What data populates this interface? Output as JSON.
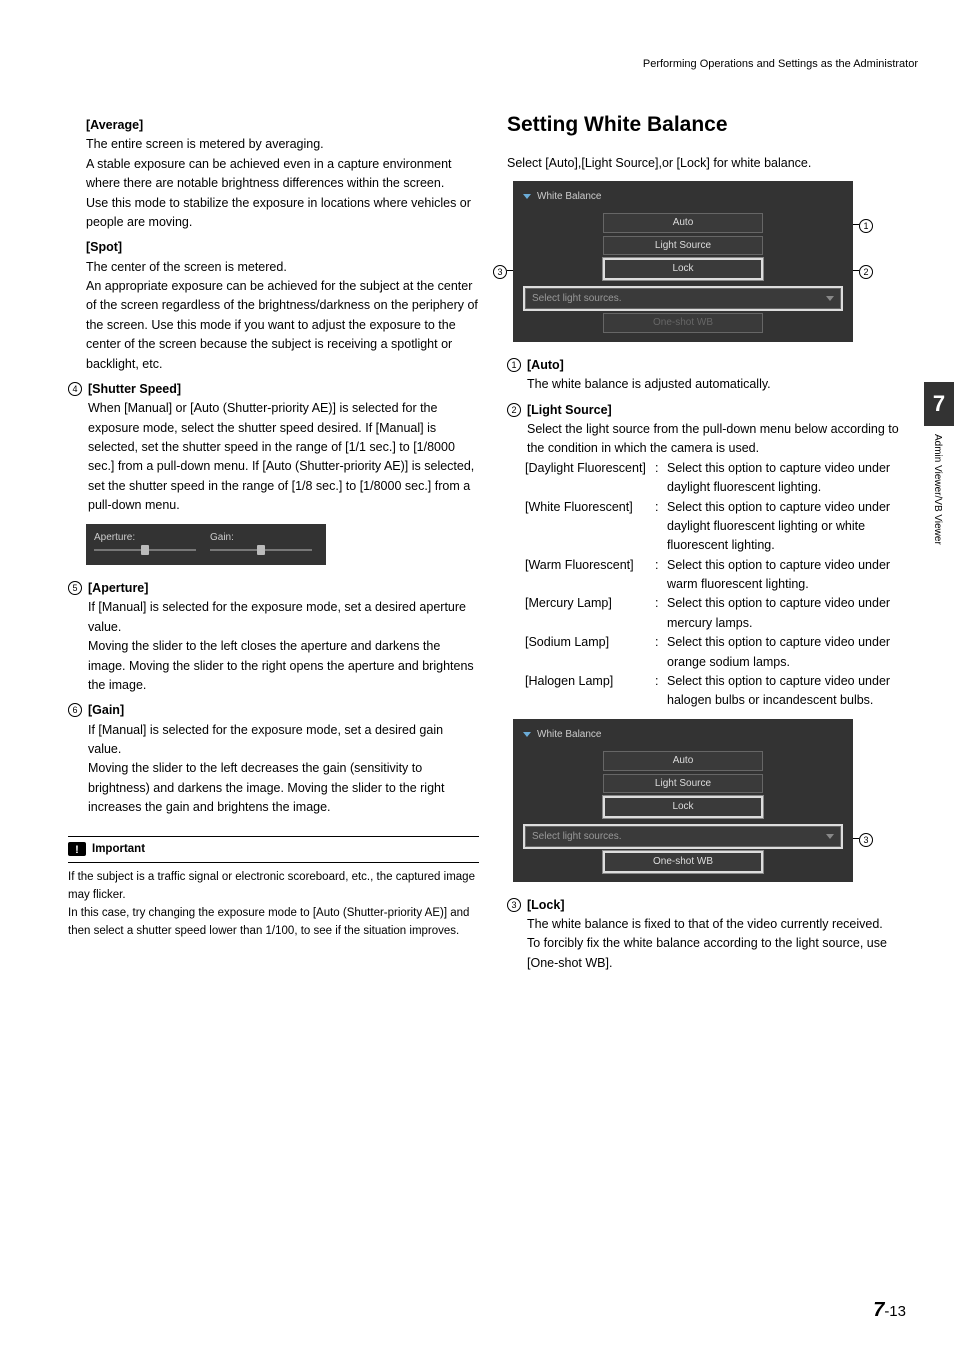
{
  "header": {
    "breadcrumb": "Performing Operations and Settings as the Administrator"
  },
  "sideTab": {
    "chapter": "7",
    "label": "Admin Viewer/VB Viewer"
  },
  "footer": {
    "chapter": "7",
    "page": "-13"
  },
  "left": {
    "avg": {
      "title": "[Average]",
      "body": "The entire screen is metered by averaging.\nA stable exposure can be achieved even in a capture environment where there are notable brightness differences within the screen.\nUse this mode to stabilize the exposure in locations where vehicles or people are moving."
    },
    "spot": {
      "title": "[Spot]",
      "body": "The center of the screen is metered.\nAn appropriate exposure can be achieved for the subject at the center of the screen regardless of the brightness/darkness on the periphery of the screen. Use this mode if you want to adjust the exposure to the center of the screen because the subject is receiving a spotlight or backlight, etc."
    },
    "shutter": {
      "num": "4",
      "title": "[Shutter Speed]",
      "body": "When [Manual] or [Auto (Shutter-priority AE)] is selected for the exposure mode, select the shutter speed desired.  If [Manual] is selected, set the shutter speed in the range of [1/1 sec.] to [1/8000 sec.] from a pull-down menu.  If [Auto (Shutter-priority AE)] is selected, set the shutter speed in the range of [1/8 sec.] to [1/8000 sec.] from a pull-down menu."
    },
    "sliders": {
      "aperture": "Aperture:",
      "gain": "Gain:"
    },
    "aperture": {
      "num": "5",
      "title": "[Aperture]",
      "body": "If [Manual] is selected for the exposure mode, set a desired aperture value.\nMoving the slider to the left closes the aperture and darkens the image. Moving the slider to the right opens the aperture and brightens the image."
    },
    "gain": {
      "num": "6",
      "title": "[Gain]",
      "body": "If [Manual] is selected for the exposure mode, set a desired gain value.\nMoving the slider to the left decreases the gain (sensitivity to brightness) and darkens the image. Moving the slider to the right increases the gain and brightens the image."
    },
    "important": {
      "title": "Important",
      "body": "If the subject is a traffic signal or electronic scoreboard, etc., the captured image may flicker.\nIn this case, try changing the exposure mode to [Auto (Shutter-priority AE)] and then select a shutter speed lower than 1/100, to see if the situation improves."
    }
  },
  "right": {
    "heading": "Setting White Balance",
    "intro": "Select [Auto],[Light Source],or [Lock] for white balance.",
    "panel": {
      "title": "White Balance",
      "btn1": "Auto",
      "btn2": "Light Source",
      "btn3": "Lock",
      "select": "Select light sources.",
      "oneshot": "One-shot WB"
    },
    "auto": {
      "num": "1",
      "title": "[Auto]",
      "body": "The white balance is adjusted automatically."
    },
    "ls": {
      "num": "2",
      "title": "[Light Source]",
      "intro": "Select the light source from the pull-down menu below according to the condition in which the camera is used.",
      "rows": [
        {
          "k": "[Daylight Fluorescent]",
          "v": "Select this option to capture video under daylight fluorescent lighting."
        },
        {
          "k": "[White Fluorescent]",
          "v": "Select this option to capture video under daylight fluorescent lighting or white fluorescent lighting."
        },
        {
          "k": "[Warm Fluorescent]",
          "v": "Select this option to capture video under warm fluorescent lighting."
        },
        {
          "k": "[Mercury Lamp]",
          "v": "Select this option to capture video under mercury lamps."
        },
        {
          "k": "[Sodium Lamp]",
          "v": "Select this option to capture video under orange sodium lamps."
        },
        {
          "k": "[Halogen Lamp]",
          "v": "Select this option to capture video under halogen bulbs or incandescent bulbs."
        }
      ]
    },
    "lock": {
      "num": "3",
      "title": "[Lock]",
      "body": "The white balance is fixed to that of the video currently received.\nTo forcibly fix the white balance according to the light source, use [One-shot WB]."
    }
  }
}
